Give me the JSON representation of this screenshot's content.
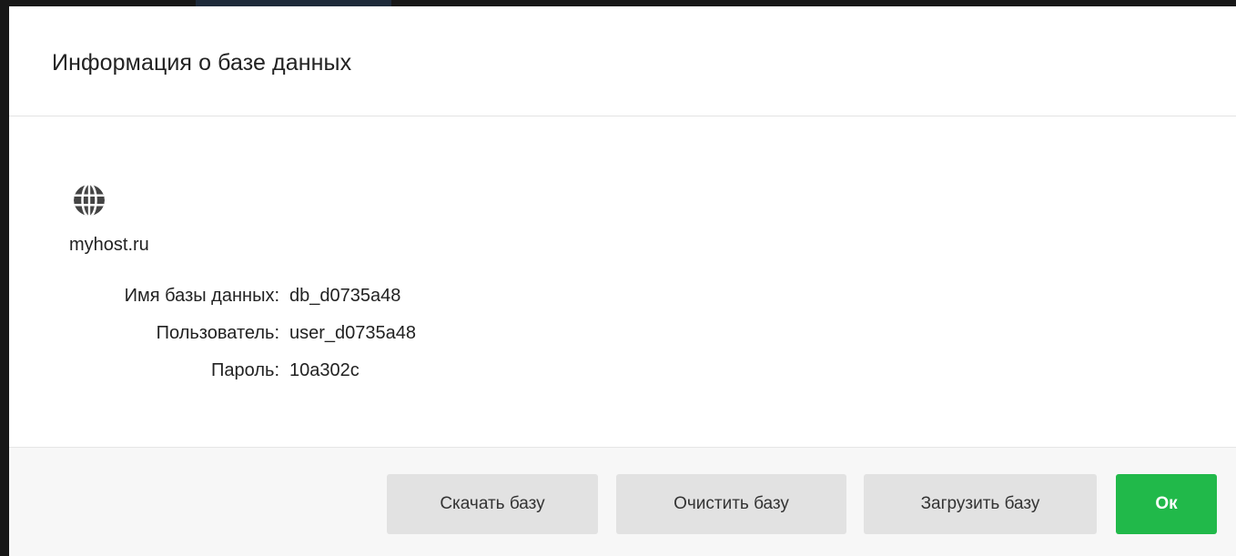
{
  "dialog": {
    "title": "Информация о базе данных"
  },
  "host": {
    "icon": "globe-icon",
    "name": "myhost.ru"
  },
  "info": [
    {
      "key": "Имя базы данных:",
      "value": "db_d0735a48"
    },
    {
      "key": "Пользователь:",
      "value": "user_d0735a48"
    },
    {
      "key": "Пароль:",
      "value": "10a302c"
    }
  ],
  "footer": {
    "download_label": "Скачать базу",
    "clear_label": "Очистить базу",
    "upload_label": "Загрузить базу",
    "ok_label": "Ок"
  },
  "colors": {
    "ok_button": "#21b94a",
    "secondary_button": "#e2e2e2",
    "footer_bg": "#f7f7f7"
  }
}
